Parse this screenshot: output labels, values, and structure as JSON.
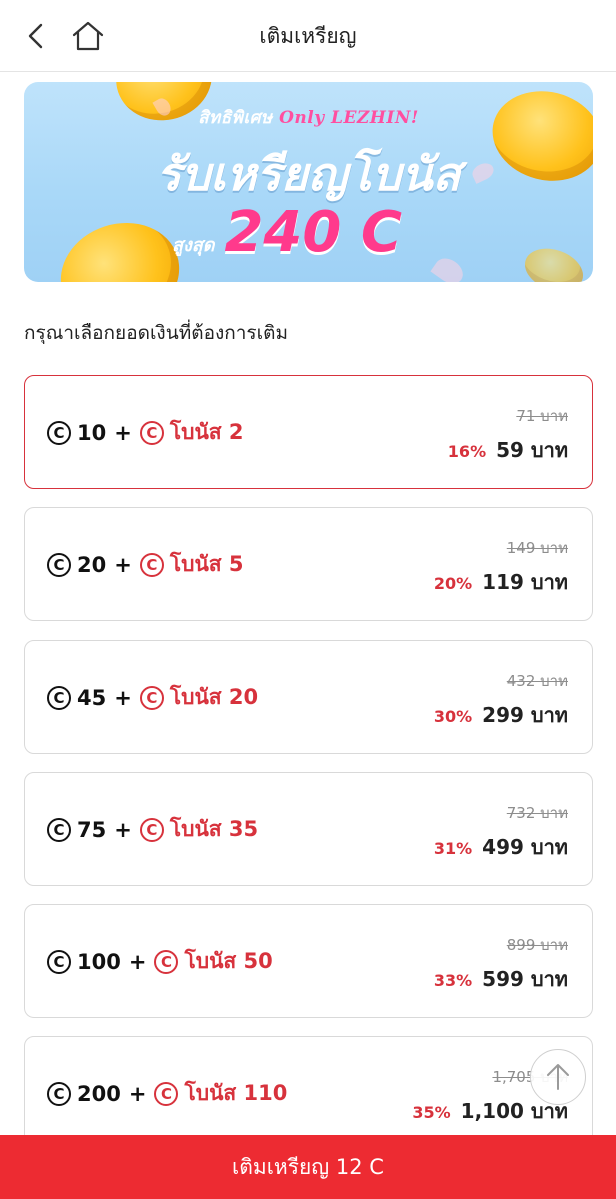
{
  "header": {
    "title": "เติมเหรียญ",
    "back_icon": "chevron-left-icon",
    "home_icon": "home-icon"
  },
  "banner": {
    "tag": "สิทธิพิเศษ",
    "tag_brand": "Only LEZHIN!",
    "headline": "รับเหรียญโบนัส",
    "max_label": "สูงสุด",
    "max_value": "240 C"
  },
  "prompt": "กรุณาเลือกยอดเงินที่ต้องการเติม",
  "coin_symbol": "C",
  "plus": "+",
  "options": [
    {
      "coins": "10",
      "bonus": "โบนัส 2",
      "original": "71 บาท",
      "discount": "16%",
      "price": "59 บาท",
      "selected": true
    },
    {
      "coins": "20",
      "bonus": "โบนัส 5",
      "original": "149 บาท",
      "discount": "20%",
      "price": "119 บาท",
      "selected": false
    },
    {
      "coins": "45",
      "bonus": "โบนัส 20",
      "original": "432 บาท",
      "discount": "30%",
      "price": "299 บาท",
      "selected": false
    },
    {
      "coins": "75",
      "bonus": "โบนัส 35",
      "original": "732 บาท",
      "discount": "31%",
      "price": "499 บาท",
      "selected": false
    },
    {
      "coins": "100",
      "bonus": "โบนัส 50",
      "original": "899 บาท",
      "discount": "33%",
      "price": "599 บาท",
      "selected": false
    },
    {
      "coins": "200",
      "bonus": "โบนัส 110",
      "original": "1,705 บาท",
      "discount": "35%",
      "price": "1,100 บาท",
      "selected": false
    }
  ],
  "scroll_top_icon": "arrow-up-icon",
  "footer": {
    "button_label": "เติมเหรียญ 12 C"
  },
  "colors": {
    "accent": "#d7323c",
    "footer": "#ed2b32",
    "banner_pink": "#ff3a8c"
  }
}
